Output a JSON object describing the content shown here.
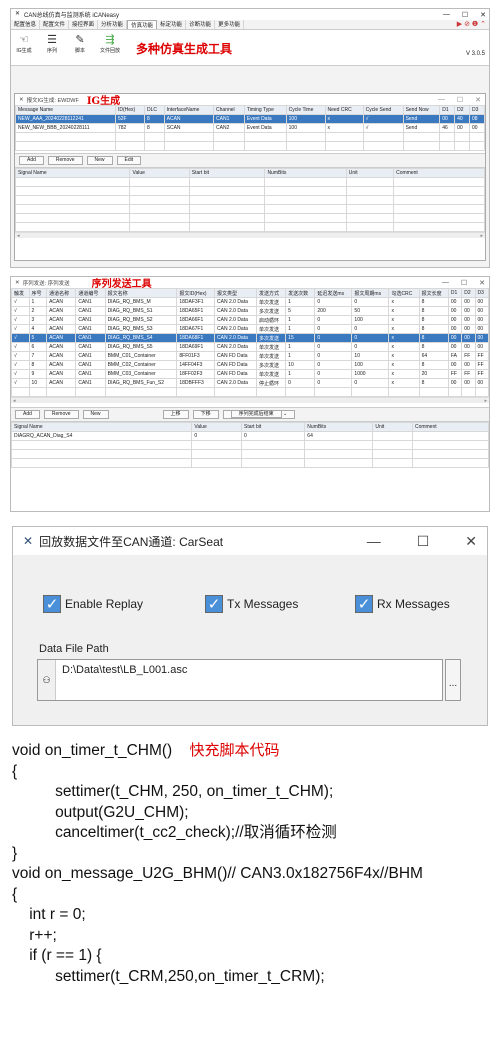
{
  "win1": {
    "title": "CAN总线仿真与监测系统 iCANeasy",
    "controls": [
      "—",
      "☐",
      "✕"
    ],
    "menu": [
      "配置信息",
      "配置文件",
      "接控界面",
      "分析功能",
      "仿真功能",
      "标定功能",
      "诊断功能",
      "更多功能"
    ],
    "tools": [
      {
        "icon": "hand-icon",
        "label": "IG生成"
      },
      {
        "icon": "list-icon",
        "label": "序列"
      },
      {
        "icon": "pen-icon",
        "label": "脚本"
      },
      {
        "icon": "replay-icon",
        "label": "文件回放"
      }
    ],
    "annotation": "多种仿真生成工具",
    "version": "V 3.0.5"
  },
  "ig": {
    "title": "报文IG生成: EWDWF",
    "annotation": "IG生成",
    "columns": [
      "Message Name",
      "ID(Hex)",
      "DLC",
      "InterfaceName",
      "Channel",
      "Timing Type",
      "Cycle Time",
      "Need CRC",
      "Cycle Send",
      "Send Now",
      "D1",
      "D2",
      "D3"
    ],
    "rows": [
      [
        "NEW_AAA_20240228112241",
        "52F",
        "8",
        "ACAN",
        "CAN1",
        "Event Data",
        "100",
        "x",
        "√",
        "Send",
        "00",
        "40",
        "08"
      ],
      [
        "NEW_NEW_BBB_20240228111",
        "782",
        "8",
        "SCAN",
        "CAN2",
        "Event Data",
        "100",
        "x",
        "√",
        "Send",
        "46",
        "00",
        "00"
      ]
    ],
    "buttons": [
      "Add",
      "Remove",
      "New",
      "Edit"
    ],
    "sig_columns": [
      "Signal Name",
      "Value",
      "Start bit",
      "NumBits",
      "Unit",
      "Comment"
    ]
  },
  "seq": {
    "title": "序列发送: 序列发送",
    "annotation": "序列发送工具",
    "columns": [
      "触发",
      "序号",
      "通道名称",
      "通道编号",
      "报文名称",
      "报文ID(Hex)",
      "报文类型",
      "发送方式",
      "发送次数",
      "延迟发送ms",
      "报文周期ms",
      "勾选CRC",
      "报文长度",
      "D1",
      "D2",
      "D3"
    ],
    "rows": [
      [
        "√",
        "1",
        "ACAN",
        "CAN1",
        "DIAG_RQ_BMS_M",
        "18DAF3F1",
        "CAN 2.0 Data",
        "单次发送",
        "1",
        "0",
        "0",
        "x",
        "8",
        "00",
        "00",
        "00"
      ],
      [
        "√",
        "2",
        "ACAN",
        "CAN1",
        "DIAG_RQ_BMS_S1",
        "18DA65F1",
        "CAN 2.0 Data",
        "多次发送",
        "5",
        "200",
        "50",
        "x",
        "8",
        "00",
        "00",
        "00"
      ],
      [
        "√",
        "3",
        "ACAN",
        "CAN1",
        "DIAG_RQ_BMS_S2",
        "18DA66F1",
        "CAN 2.0 Data",
        "启动循环",
        "1",
        "0",
        "100",
        "x",
        "8",
        "00",
        "00",
        "00"
      ],
      [
        "√",
        "4",
        "ACAN",
        "CAN1",
        "DIAG_RQ_BMS_S3",
        "18DA67F1",
        "CAN 2.0 Data",
        "单次发送",
        "1",
        "0",
        "0",
        "x",
        "8",
        "00",
        "00",
        "00"
      ],
      [
        "√",
        "5",
        "ACAN",
        "CAN1",
        "DIAG_RQ_BMS_S4",
        "18DA68F1",
        "CAN 2.0 Data",
        "多次发送",
        "15",
        "0",
        "0",
        "x",
        "8",
        "00",
        "00",
        "00"
      ],
      [
        "√",
        "6",
        "ACAN",
        "CAN1",
        "DIAG_RQ_BMS_S5",
        "18DA69F1",
        "CAN 2.0 Data",
        "单次发送",
        "1",
        "0",
        "0",
        "x",
        "8",
        "00",
        "00",
        "00"
      ],
      [
        "√",
        "7",
        "ACAN",
        "CAN1",
        "BMM_C01_Container",
        "8FF01F3",
        "CAN FD Data",
        "单次发送",
        "1",
        "0",
        "10",
        "x",
        "64",
        "FA",
        "FF",
        "FF"
      ],
      [
        "√",
        "8",
        "ACAN",
        "CAN1",
        "BMM_C02_Container",
        "14FF04F3",
        "CAN FD Data",
        "多次发送",
        "10",
        "0",
        "100",
        "x",
        "8",
        "00",
        "00",
        "FF"
      ],
      [
        "√",
        "9",
        "ACAN",
        "CAN1",
        "BMM_C03_Container",
        "18FF02F3",
        "CAN FD Data",
        "单次发送",
        "1",
        "0",
        "1000",
        "x",
        "20",
        "FF",
        "FF",
        "FF"
      ],
      [
        "√",
        "10",
        "ACAN",
        "CAN1",
        "DIAG_RQ_BMS_Fun_S2",
        "18DBFFF3",
        "CAN 2.0 Data",
        "停止循环",
        "0",
        "0",
        "0",
        "x",
        "8",
        "00",
        "00",
        "00"
      ]
    ],
    "buttons": [
      "Add",
      "Remove",
      "New",
      "上移",
      "下移"
    ],
    "select": "序列完成后结束",
    "sig_columns": [
      "Signal Name",
      "Value",
      "Start bit",
      "NumBits",
      "Unit",
      "Comment"
    ],
    "sig_row": [
      "DIAGRQ_ACAN_Diag_S4",
      "0",
      "0",
      "64",
      "",
      ""
    ]
  },
  "replay": {
    "title": "回放数据文件至CAN通道: CarSeat",
    "enable": "Enable Replay",
    "tx": "Tx Messages",
    "rx": "Rx Messages",
    "path_label": "Data File Path",
    "path": "D:\\Data\\test\\LB_L001.asc",
    "browse": "..."
  },
  "code": {
    "annotation": "快充脚本代码",
    "lines": [
      "void on_timer_t_CHM()",
      "{",
      "          settimer(t_CHM, 250, on_timer_t_CHM);",
      "          output(G2U_CHM);",
      "          canceltimer(t_cc2_check);//取消循环检测",
      "}",
      "",
      "void on_message_U2G_BHM()// CAN3.0x182756F4x//BHM",
      "{",
      "    int r = 0;",
      "    r++;",
      "    if (r == 1) {",
      "          settimer(t_CRM,250,on_timer_t_CRM);"
    ]
  }
}
